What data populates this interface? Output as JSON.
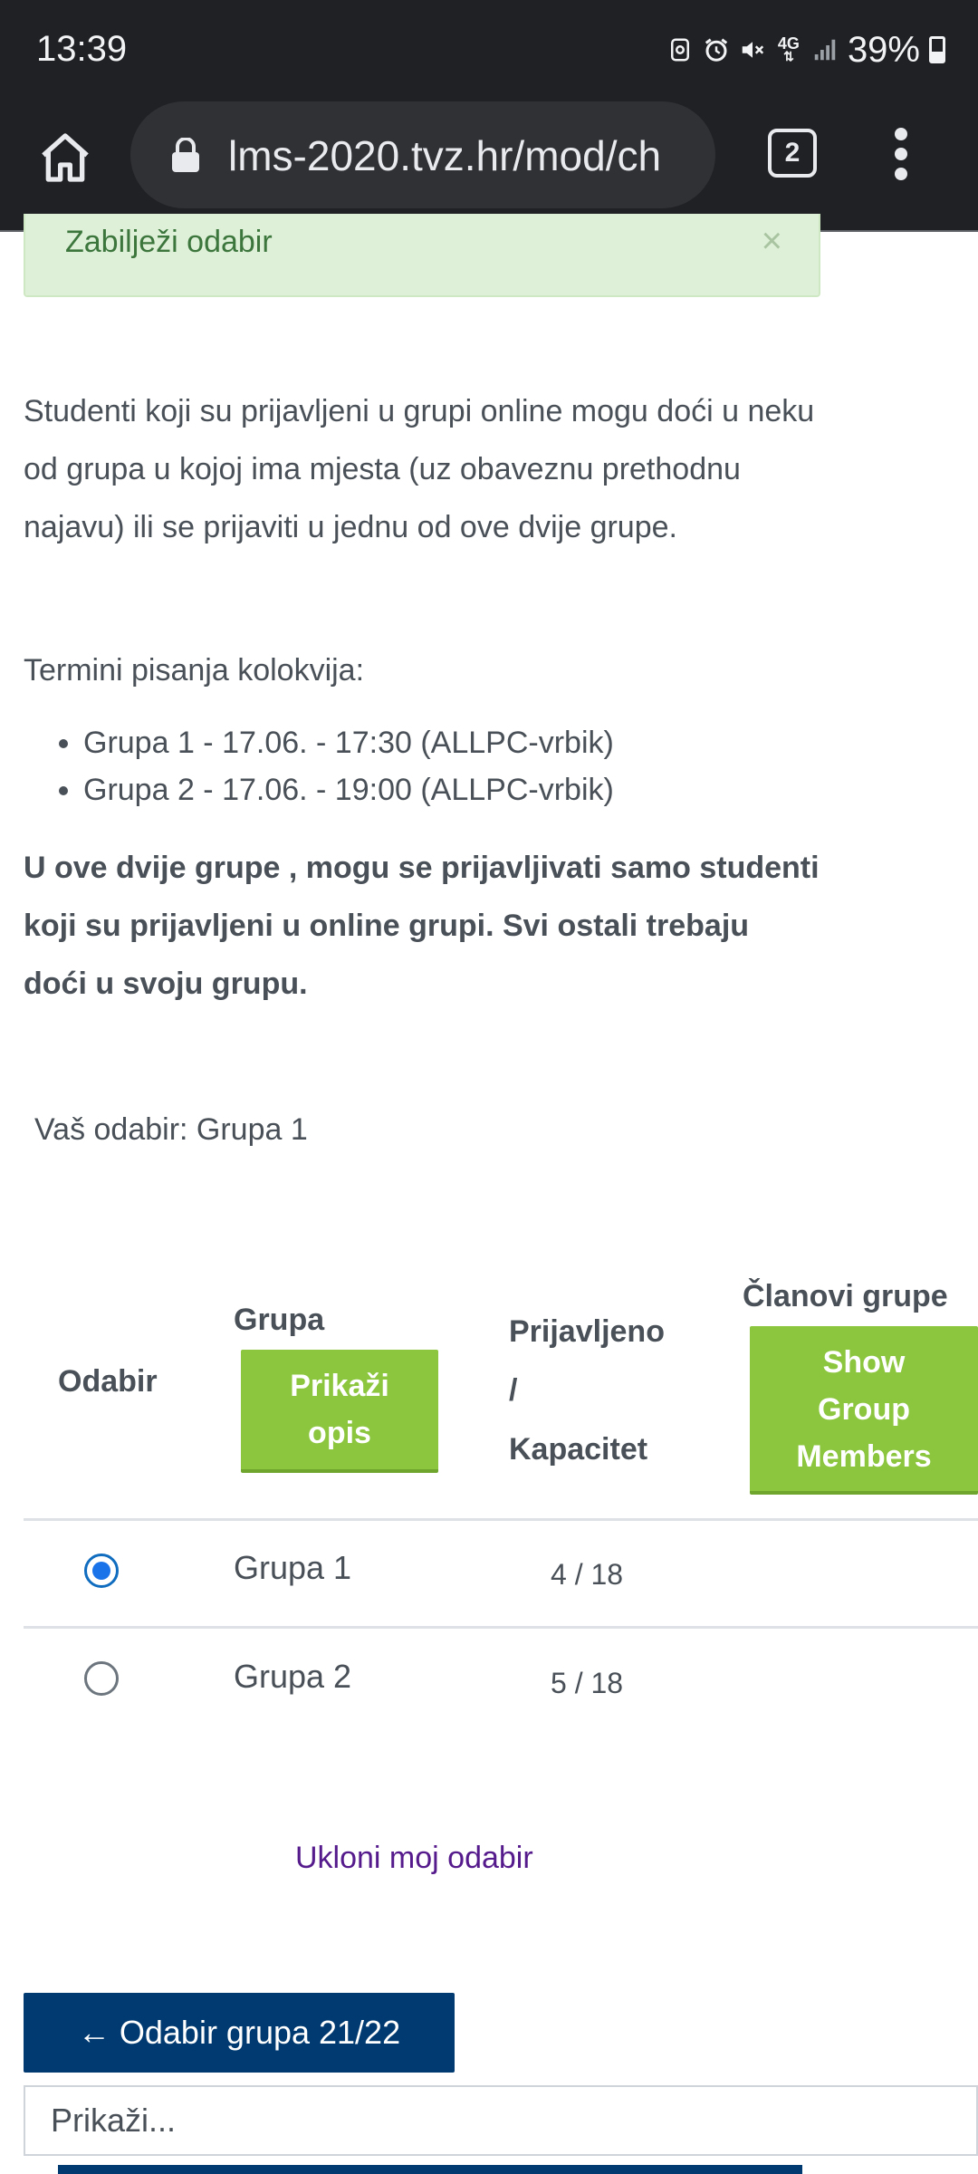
{
  "status_bar": {
    "time": "13:39",
    "network": "4G",
    "battery": "39%",
    "icons": [
      "sync-icon",
      "alarm-icon",
      "mute-icon",
      "network-4g-icon",
      "signal-icon",
      "battery-icon"
    ]
  },
  "browser": {
    "url": "lms-2020.tvz.hr/mod/ch",
    "tab_count": "2"
  },
  "alert": {
    "text": "Zabilježi odabir",
    "close": "×"
  },
  "content": {
    "intro": "Studenti koji su prijavljeni u grupi online mogu doći u neku od grupa u kojoj ima mjesta (uz obaveznu prethodnu najavu) ili se prijaviti u jednu od ove dvije grupe.",
    "terms_heading": "Termini pisanja kolokvija:",
    "terms": [
      "Grupa 1 - 17.06. - 17:30 (ALLPC-vrbik)",
      "Grupa 2 - 17.06. - 19:00 (ALLPC-vrbik)"
    ],
    "notice": "U ove dvije grupe , mogu se prijavljivati samo studenti koji su prijavljeni u online grupi. Svi ostali trebaju doći u svoju grupu.",
    "your_choice": "Vaš odabir: Grupa 1"
  },
  "table": {
    "headers": {
      "choice": "Odabir",
      "group": "Grupa",
      "show_description": "Prikaži opis",
      "registered_line1": "Prijavljeno",
      "registered_line2": "/",
      "registered_line3": "Kapacitet",
      "members": "Članovi grupe",
      "show_members_line1": "Show",
      "show_members_line2": "Group",
      "show_members_line3": "Members"
    },
    "rows": [
      {
        "group": "Grupa 1",
        "count": "4 / 18",
        "selected": true
      },
      {
        "group": "Grupa 2",
        "count": "5 / 18",
        "selected": false
      }
    ]
  },
  "actions": {
    "remove_choice": "Ukloni moj odabir",
    "back_button": "← Odabir grupa 21/22",
    "jump_select": "Prikaži..."
  },
  "colors": {
    "green_button": "#8cc63f",
    "primary": "#003a70",
    "alert_bg": "#dff0d8",
    "link": "#551a8b"
  }
}
